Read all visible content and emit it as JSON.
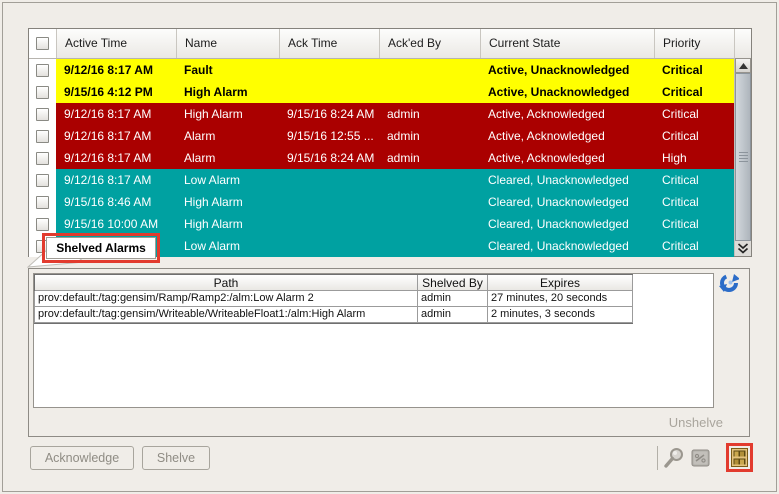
{
  "colors": {
    "row_active_unacknowledged": "#ffff00",
    "row_active_acknowledged": "#aa0000",
    "row_cleared": "#00a1a1",
    "annotation_red": "#e23b2e",
    "background": "#f0ede8"
  },
  "alarm_table": {
    "columns": [
      "Active Time",
      "Name",
      "Ack Time",
      "Ack'ed By",
      "Current State",
      "Priority"
    ],
    "rows": [
      {
        "active_time": "9/12/16 8:17 AM",
        "name": "Fault",
        "ack_time": "",
        "acked_by": "",
        "current_state": "Active, Unacknowledged",
        "priority": "Critical"
      },
      {
        "active_time": "9/15/16 4:12 PM",
        "name": "High Alarm",
        "ack_time": "",
        "acked_by": "",
        "current_state": "Active, Unacknowledged",
        "priority": "Critical"
      },
      {
        "active_time": "9/12/16 8:17 AM",
        "name": "High Alarm",
        "ack_time": "9/15/16 8:24 AM",
        "acked_by": "admin",
        "current_state": "Active, Acknowledged",
        "priority": "Critical"
      },
      {
        "active_time": "9/12/16 8:17 AM",
        "name": "Alarm",
        "ack_time": "9/15/16 12:55 ...",
        "acked_by": "admin",
        "current_state": "Active, Acknowledged",
        "priority": "Critical"
      },
      {
        "active_time": "9/12/16 8:17 AM",
        "name": "Alarm",
        "ack_time": "9/15/16 8:24 AM",
        "acked_by": "admin",
        "current_state": "Active, Acknowledged",
        "priority": "High"
      },
      {
        "active_time": "9/12/16 8:17 AM",
        "name": "Low Alarm",
        "ack_time": "",
        "acked_by": "",
        "current_state": "Cleared, Unacknowledged",
        "priority": "Critical"
      },
      {
        "active_time": "9/15/16 8:46 AM",
        "name": "High Alarm",
        "ack_time": "",
        "acked_by": "",
        "current_state": "Cleared, Unacknowledged",
        "priority": "Critical"
      },
      {
        "active_time": "9/15/16 10:00 AM",
        "name": "High Alarm",
        "ack_time": "",
        "acked_by": "",
        "current_state": "Cleared, Unacknowledged",
        "priority": "Critical"
      },
      {
        "active_time": "",
        "name": "Low Alarm",
        "ack_time": "",
        "acked_by": "",
        "current_state": "Cleared, Unacknowledged",
        "priority": "Critical"
      }
    ]
  },
  "tooltip": {
    "label": "Shelved Alarms"
  },
  "shelved_panel": {
    "columns": [
      "Path",
      "Shelved By",
      "Expires"
    ],
    "rows": [
      {
        "path": "prov:default:/tag:gensim/Ramp/Ramp2:/alm:Low Alarm 2",
        "shelved_by": "admin",
        "expires": "27 minutes, 20 seconds"
      },
      {
        "path": "prov:default:/tag:gensim/Writeable/WriteableFloat1:/alm:High Alarm",
        "shelved_by": "admin",
        "expires": "2 minutes, 3 seconds"
      }
    ],
    "unshelve_label": "Unshelve"
  },
  "footer": {
    "acknowledge_label": "Acknowledge",
    "shelve_label": "Shelve"
  },
  "icons": {
    "refresh": "refresh-icon",
    "search": "search-icon",
    "edit": "edit-icon",
    "shelf": "shelved-alarms-icon",
    "scroll_up": "chevron-up-icon",
    "scroll_more": "double-chevron-down-icon"
  }
}
